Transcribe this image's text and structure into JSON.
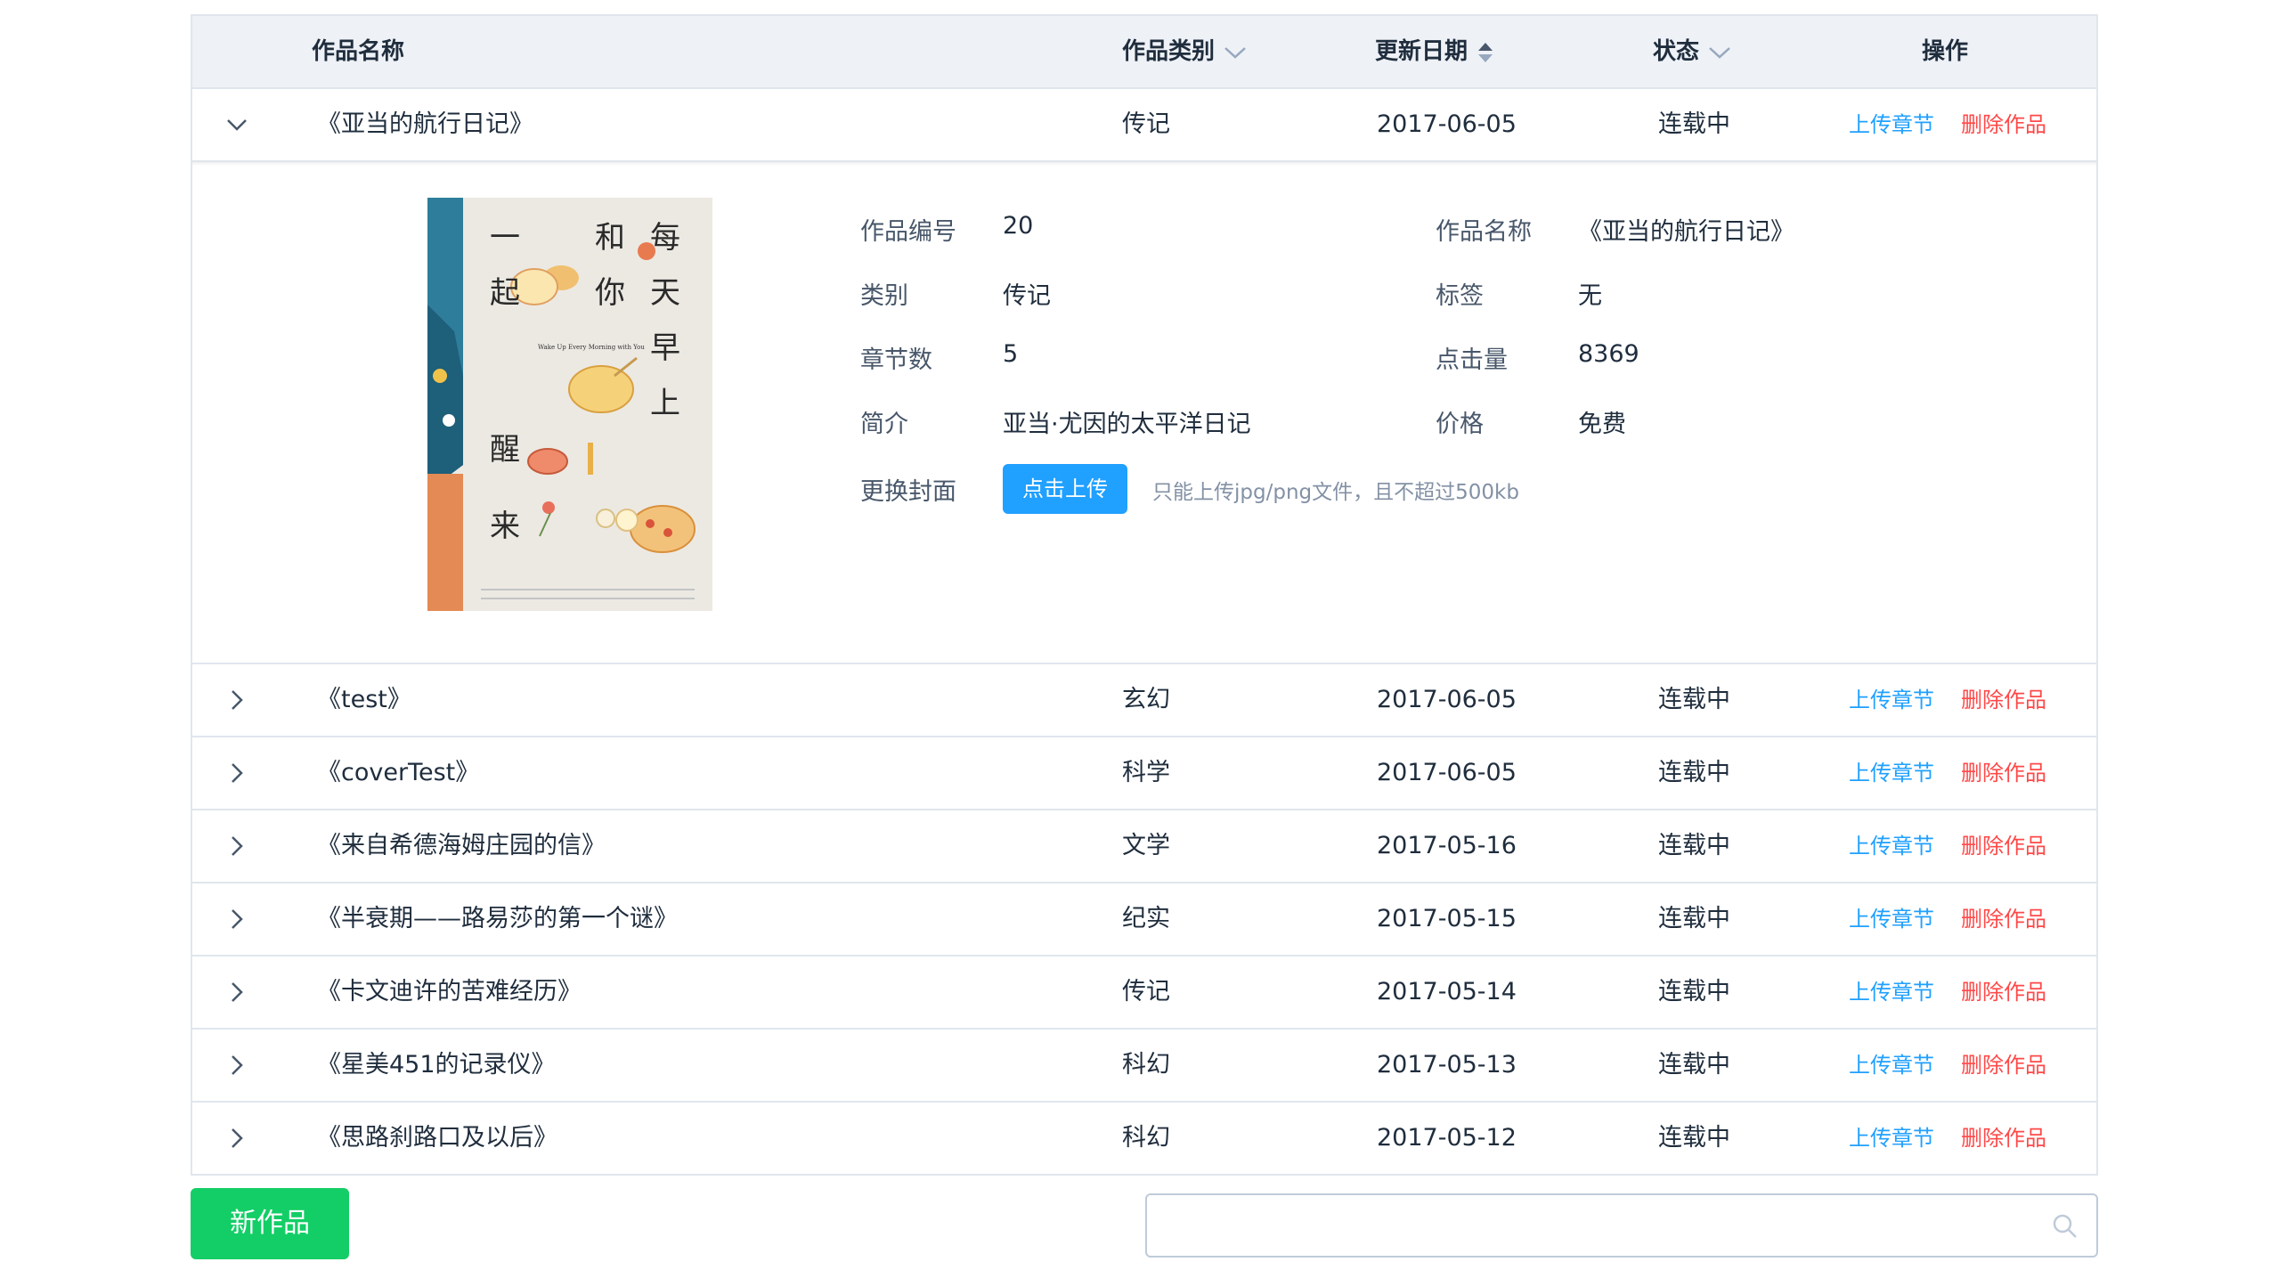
{
  "table": {
    "headers": {
      "name": "作品名称",
      "category": "作品类别",
      "date": "更新日期",
      "status": "状态",
      "actions": "操作"
    },
    "action_labels": {
      "upload": "上传章节",
      "delete": "删除作品"
    },
    "expanded_row": {
      "name": "《亚当的航行日记》",
      "category": "传记",
      "date": "2017-06-05",
      "status": "连载中"
    },
    "detail": {
      "id_label": "作品编号",
      "id_value": "20",
      "name_label": "作品名称",
      "name_value": "《亚当的航行日记》",
      "category_label": "类别",
      "category_value": "传记",
      "tags_label": "标签",
      "tags_value": "无",
      "chapters_label": "章节数",
      "chapters_value": "5",
      "clicks_label": "点击量",
      "clicks_value": "8369",
      "intro_label": "简介",
      "intro_value": "亚当·尤因的太平洋日记",
      "price_label": "价格",
      "price_value": "免费",
      "cover_label": "更换封面",
      "upload_button": "点击上传",
      "upload_tip": "只能上传jpg/png文件，且不超过500kb",
      "cover_art": {
        "title_chars": [
          "每",
          "天",
          "早",
          "上",
          "和",
          "你",
          "一",
          "起",
          "醒",
          "来"
        ],
        "english": "Wake Up Every Morning with You"
      }
    },
    "rows": [
      {
        "name": "《test》",
        "category": "玄幻",
        "date": "2017-06-05",
        "status": "连载中"
      },
      {
        "name": "《coverTest》",
        "category": "科学",
        "date": "2017-06-05",
        "status": "连载中"
      },
      {
        "name": "《来自希德海姆庄园的信》",
        "category": "文学",
        "date": "2017-05-16",
        "status": "连载中"
      },
      {
        "name": "《半衰期——路易莎的第一个谜》",
        "category": "纪实",
        "date": "2017-05-15",
        "status": "连载中"
      },
      {
        "name": "《卡文迪许的苦难经历》",
        "category": "传记",
        "date": "2017-05-14",
        "status": "连载中"
      },
      {
        "name": "《星美451的记录仪》",
        "category": "科幻",
        "date": "2017-05-13",
        "status": "连载中"
      },
      {
        "name": "《思路刹路口及以后》",
        "category": "科幻",
        "date": "2017-05-12",
        "status": "连载中"
      }
    ]
  },
  "new_button": "新作品",
  "search": {
    "value": "",
    "placeholder": ""
  },
  "colors": {
    "primary": "#20a0ff",
    "danger": "#ff4949",
    "success": "#13ce66",
    "header_bg": "#eef1f6"
  }
}
